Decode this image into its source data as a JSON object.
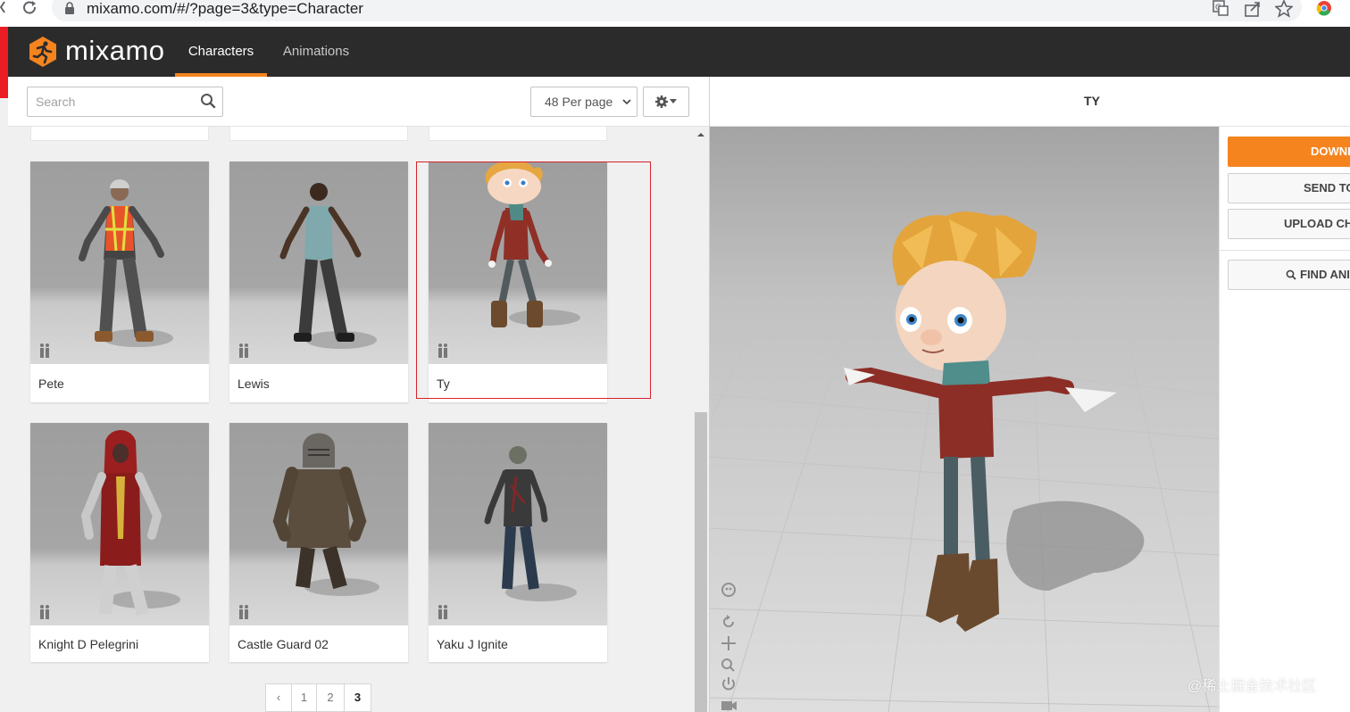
{
  "browser": {
    "url": "mixamo.com/#/?page=3&type=Character",
    "icons": [
      "reload-icon",
      "lock-icon",
      "translate-icon",
      "share-icon",
      "star-icon",
      "chrome-extension-icon"
    ]
  },
  "header": {
    "logo_text": "mixamo",
    "tabs": [
      {
        "label": "Characters",
        "active": true
      },
      {
        "label": "Animations",
        "active": false
      }
    ],
    "accent_color": "#f5841f",
    "background_color": "#2b2b2b"
  },
  "toolbar": {
    "search_placeholder": "Search",
    "per_page_label": "48 Per page"
  },
  "preview": {
    "title": "TY"
  },
  "characters": [
    {
      "name": "Pete"
    },
    {
      "name": "Lewis"
    },
    {
      "name": "Ty",
      "selected": true
    },
    {
      "name": "Knight D Pelegrini"
    },
    {
      "name": "Castle Guard 02"
    },
    {
      "name": "Yaku J Ignite"
    }
  ],
  "pagination": {
    "prev_label": "‹",
    "pages": [
      "1",
      "2",
      "3"
    ],
    "current": "3"
  },
  "actions": {
    "download": "DOWNL",
    "send_to": "SEND TO",
    "upload": "UPLOAD CH",
    "find": "FIND ANI"
  },
  "watermark": "@稀土掘金技术社区"
}
